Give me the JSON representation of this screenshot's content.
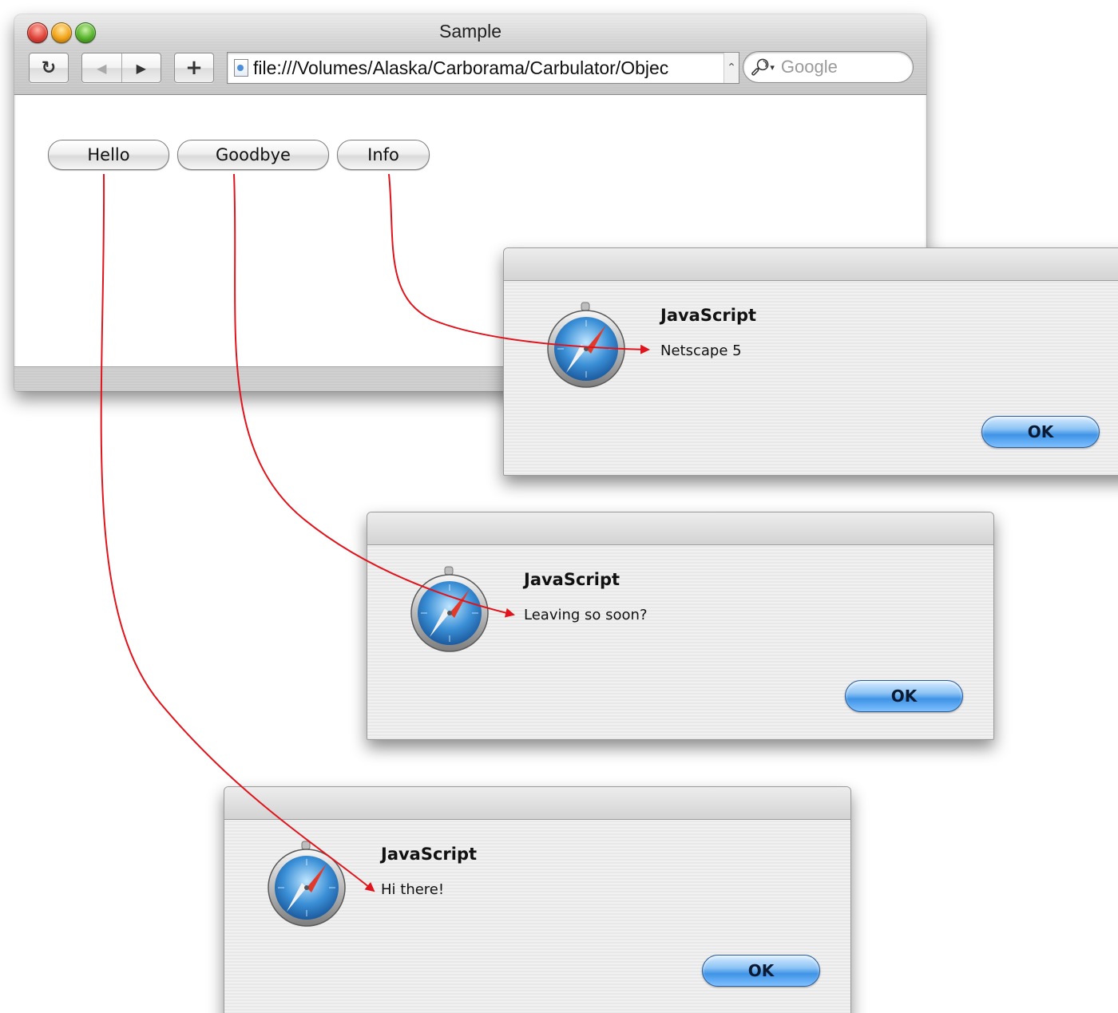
{
  "browser": {
    "title": "Sample",
    "url": "file:///Volumes/Alaska/Carborama/Carbulator/Objec",
    "search_placeholder": "Google",
    "toolbar": {
      "reload_icon": "reload-icon",
      "back_icon": "back-arrow-icon",
      "forward_icon": "forward-arrow-icon",
      "add_bookmark_icon": "plus-icon"
    },
    "buttons": [
      "Hello",
      "Goodbye",
      "Info"
    ]
  },
  "dialogs": [
    {
      "heading": "JavaScript",
      "message": "Netscape 5",
      "ok_label": "OK",
      "icon": "safari-compass-icon"
    },
    {
      "heading": "JavaScript",
      "message": "Leaving so soon?",
      "ok_label": "OK",
      "icon": "safari-compass-icon"
    },
    {
      "heading": "JavaScript",
      "message": "Hi there!",
      "ok_label": "OK",
      "icon": "safari-compass-icon"
    }
  ],
  "colors": {
    "arrow": "#e0141c",
    "ok_button": "#4a9ae8"
  }
}
